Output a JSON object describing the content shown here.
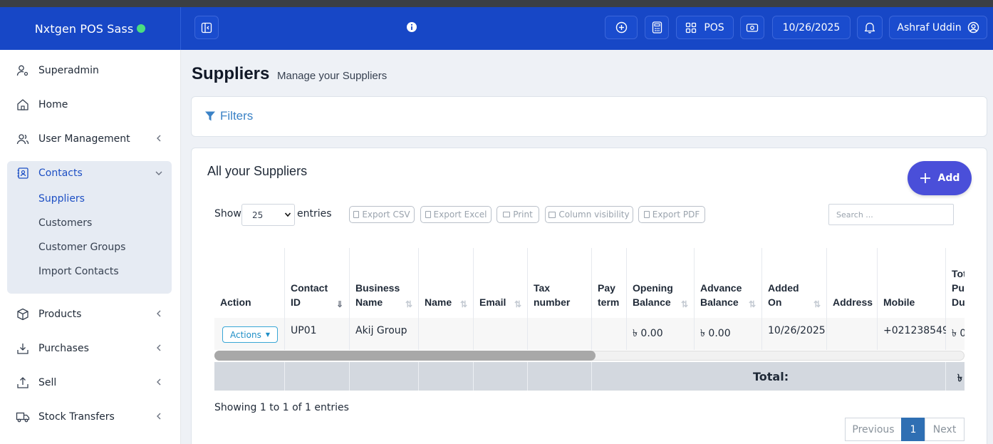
{
  "app": {
    "brand": "Nxtgen POS Sass",
    "status_color": "#4ade80"
  },
  "topbar": {
    "pos_label": "POS",
    "date": "10/26/2025",
    "user": "Ashraf Uddin"
  },
  "sidebar": {
    "items": [
      {
        "label": "Superadmin"
      },
      {
        "label": "Home"
      },
      {
        "label": "User Management"
      },
      {
        "label": "Contacts"
      },
      {
        "label": "Products"
      },
      {
        "label": "Purchases"
      },
      {
        "label": "Sell"
      },
      {
        "label": "Stock Transfers"
      }
    ],
    "contacts_sub": [
      "Suppliers",
      "Customers",
      "Customer Groups",
      "Import Contacts"
    ]
  },
  "page": {
    "title": "Suppliers",
    "subtitle": "Manage your Suppliers"
  },
  "filters": {
    "label": "Filters"
  },
  "suppliers": {
    "box_title": "All your Suppliers",
    "add_label": "Add",
    "show_label": "Show",
    "entries_value": "25",
    "entries_label": "entries",
    "export_buttons": [
      "Export CSV",
      "Export Excel",
      "Print",
      "Column visibility",
      "Export PDF"
    ],
    "search_placeholder": "Search ...",
    "columns": [
      {
        "l1": "Action",
        "l2": ""
      },
      {
        "l1": "Contact",
        "l2": "ID"
      },
      {
        "l1": "Business",
        "l2": "Name"
      },
      {
        "l1": "Name",
        "l2": ""
      },
      {
        "l1": "Email",
        "l2": ""
      },
      {
        "l1": "Tax",
        "l2": "number"
      },
      {
        "l1": "Pay",
        "l2": "term"
      },
      {
        "l1": "Opening",
        "l2": "Balance"
      },
      {
        "l1": "Advance",
        "l2": "Balance"
      },
      {
        "l1": "Added",
        "l2": "On"
      },
      {
        "l1": "Address",
        "l2": ""
      },
      {
        "l1": "Mobile",
        "l2": ""
      },
      {
        "l1": "Tot",
        "l2": "Pu",
        "l3": "Du"
      }
    ],
    "row": {
      "actions_label": "Actions",
      "cells": [
        "",
        "UP01",
        "Akij Group",
        "",
        "",
        "",
        "",
        "৳ 0.00",
        "৳ 0.00",
        "10/26/2025",
        "",
        "+021238549",
        "৳ 0"
      ]
    },
    "total_label": "Total:",
    "total_partial": "৳",
    "showing_text": "Showing 1 to 1 of 1 entries",
    "pager": {
      "prev": "Previous",
      "page": "1",
      "next": "Next"
    }
  }
}
